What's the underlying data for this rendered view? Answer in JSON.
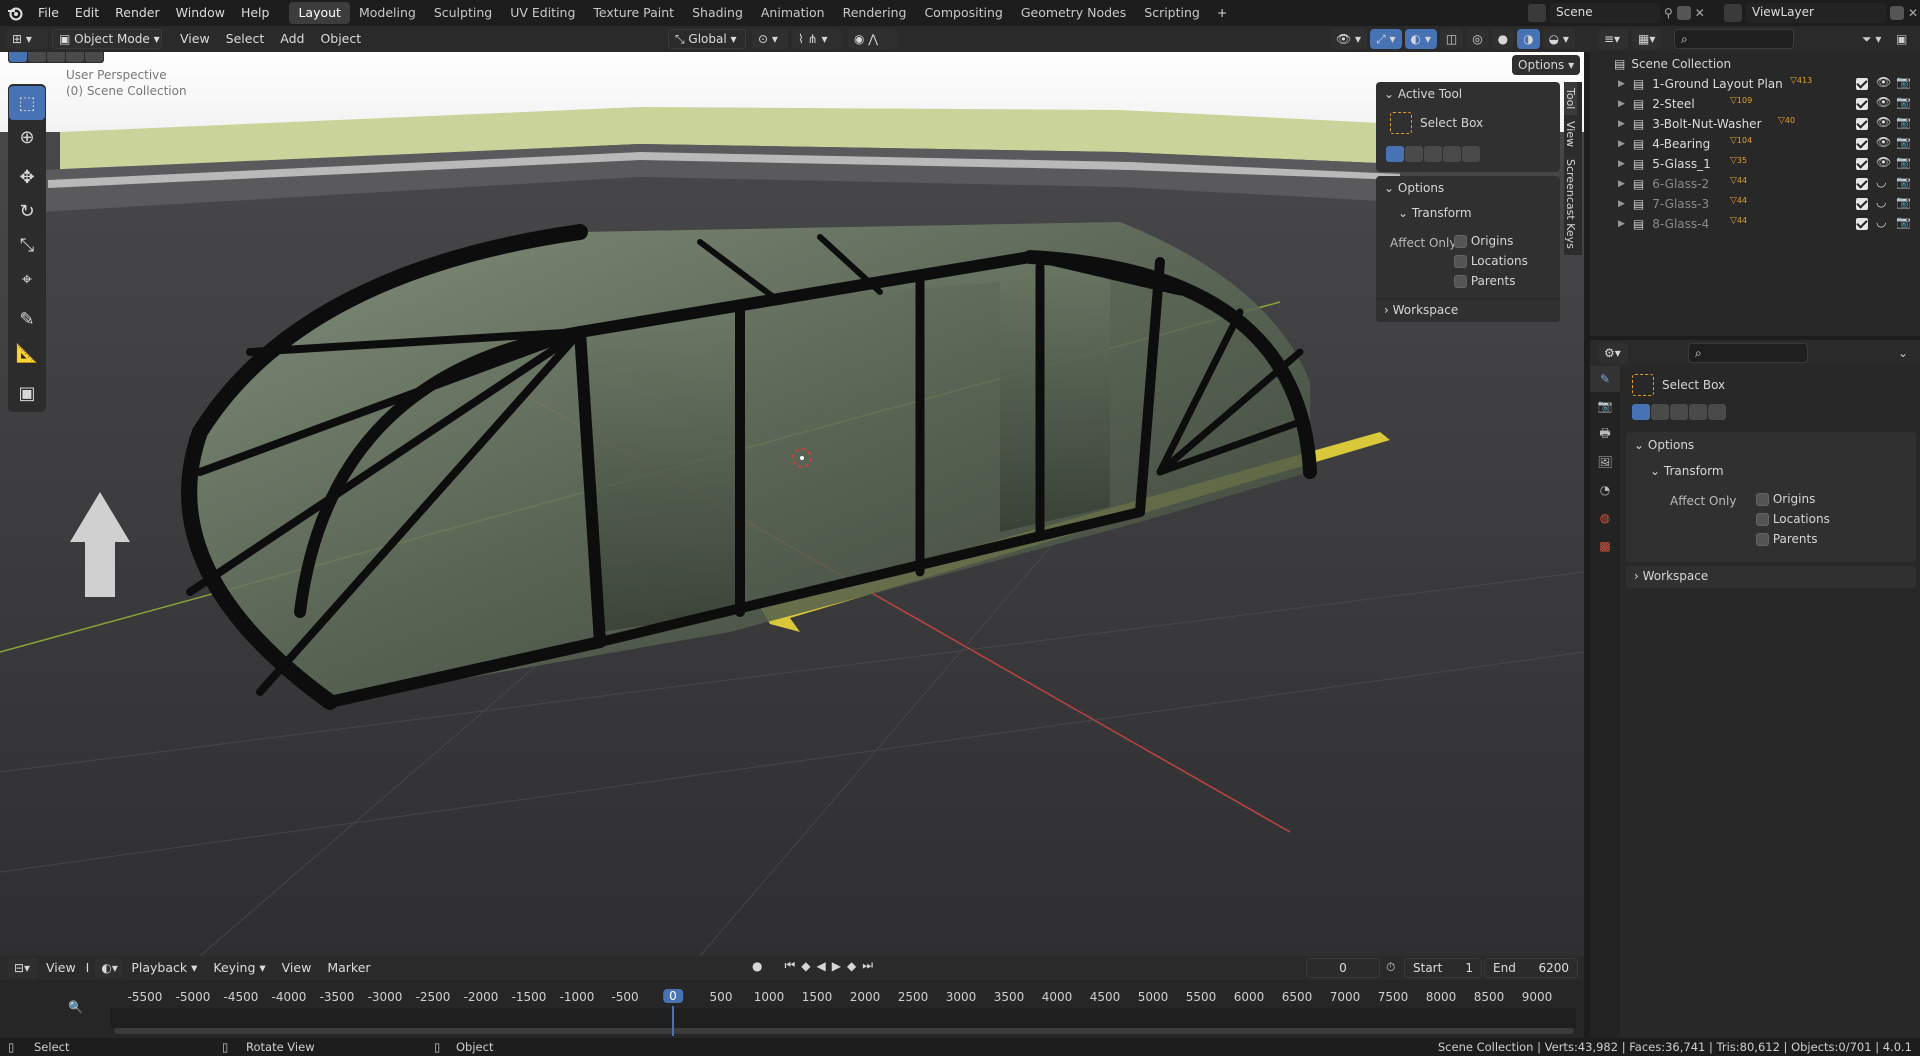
{
  "app": {
    "menus": [
      "File",
      "Edit",
      "Render",
      "Window",
      "Help"
    ],
    "workspaces": [
      "Layout",
      "Modeling",
      "Sculpting",
      "UV Editing",
      "Texture Paint",
      "Shading",
      "Animation",
      "Rendering",
      "Compositing",
      "Geometry Nodes",
      "Scripting"
    ],
    "active_workspace": "Layout",
    "add_tab": "+",
    "scene": "Scene",
    "view_layer": "ViewLayer"
  },
  "viewport_header": {
    "mode": "Object Mode",
    "menus": [
      "View",
      "Select",
      "Add",
      "Object"
    ],
    "transform_orientation": "Global",
    "options_label": "Options"
  },
  "viewport": {
    "overlay_title": "User Perspective",
    "overlay_subtitle": "(0) Scene Collection",
    "side_tabs": [
      "Tool",
      "View",
      "Screencast Keys"
    ]
  },
  "n_panel": {
    "active_tool_title": "Active Tool",
    "tool_name": "Select Box",
    "options_title": "Options",
    "transform_title": "Transform",
    "affect_only_label": "Affect Only",
    "affect_items": [
      "Origins",
      "Locations",
      "Parents"
    ],
    "workspace_title": "Workspace"
  },
  "outliner": {
    "root": "Scene Collection",
    "items": [
      {
        "name": "1-Ground Layout Plan",
        "badge": "413",
        "enabled": true
      },
      {
        "name": "2-Steel",
        "badge": "109",
        "enabled": true
      },
      {
        "name": "3-Bolt-Nut-Washer",
        "badge": "40",
        "enabled": true
      },
      {
        "name": "4-Bearing",
        "badge": "104",
        "enabled": true
      },
      {
        "name": "5-Glass_1",
        "badge": "35",
        "enabled": true
      },
      {
        "name": "6-Glass-2",
        "badge": "44",
        "enabled": false
      },
      {
        "name": "7-Glass-3",
        "badge": "44",
        "enabled": false
      },
      {
        "name": "8-Glass-4",
        "badge": "44",
        "enabled": false
      }
    ]
  },
  "properties": {
    "tool_name": "Select Box",
    "options_title": "Options",
    "transform_title": "Transform",
    "affect_only_label": "Affect Only",
    "affect_items": [
      "Origins",
      "Locations",
      "Parents"
    ],
    "workspace_title": "Workspace"
  },
  "timeline": {
    "menus": [
      "View",
      "Playback",
      "Keying",
      "View",
      "Marker"
    ],
    "clipped_label": "I",
    "current_frame": "0",
    "start_label": "Start",
    "start_value": "1",
    "end_label": "End",
    "end_value": "6200",
    "ticks": [
      "-5500",
      "-5000",
      "-4500",
      "-4000",
      "-3500",
      "-3000",
      "-2500",
      "-2000",
      "-1500",
      "-1000",
      "-500",
      "0",
      "500",
      "1000",
      "1500",
      "2000",
      "2500",
      "3000",
      "3500",
      "4000",
      "4500",
      "5000",
      "5500",
      "6000",
      "6500",
      "7000",
      "7500",
      "8000",
      "8500",
      "9000"
    ]
  },
  "statusbar": {
    "select": "Select",
    "rotate": "Rotate View",
    "object": "Object",
    "stats": "Scene Collection | Verts:43,982 | Faces:36,741 | Tris:80,612 | Objects:0/701 | 4.0.1"
  },
  "colors": {
    "accent": "#4772b3",
    "active_frame": "#4772b3",
    "paint_yellow": "#d8c83a"
  }
}
